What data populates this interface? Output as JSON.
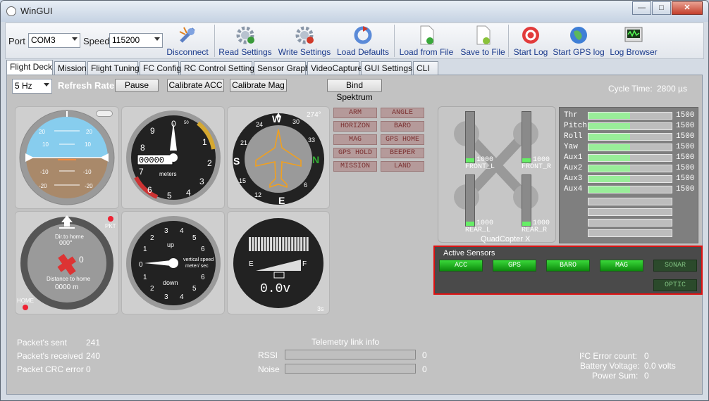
{
  "window": {
    "title": "WinGUI",
    "minimize": "—",
    "maximize": "□",
    "close": "✕"
  },
  "toolbar": {
    "port_label": "Port",
    "port_value": "COM3",
    "speed_label": "Speed",
    "speed_value": "115200",
    "buttons": [
      {
        "label": "Disconnect",
        "icon": "plug-disconnect-icon"
      },
      {
        "label": "Read Settings",
        "icon": "gear-read-icon"
      },
      {
        "label": "Write Settings",
        "icon": "gear-write-icon"
      },
      {
        "label": "Load Defaults",
        "icon": "reload-icon"
      },
      {
        "label": "Load from File",
        "icon": "file-load-icon"
      },
      {
        "label": "Save to File",
        "icon": "file-save-icon"
      },
      {
        "label": "Start Log",
        "icon": "record-icon"
      },
      {
        "label": "Start GPS log",
        "icon": "globe-icon"
      },
      {
        "label": "Log Browser",
        "icon": "log-browser-icon"
      }
    ]
  },
  "tabs": [
    "Flight Deck",
    "Mission",
    "Flight Tuning",
    "FC Config",
    "RC Control Settings",
    "Sensor Graph",
    "VideoCapture",
    "GUI Settings",
    "CLI"
  ],
  "controls": {
    "refresh_value": "5 Hz",
    "refresh_label": "Refresh Rate",
    "pause": "Pause",
    "calibrate_acc": "Calibrate ACC",
    "calibrate_mag": "Calibrate Mag",
    "bind": "Bind Spektrum",
    "cycle_label": "Cycle Time:",
    "cycle_value": "2800 µs"
  },
  "attitude": {
    "pitch_labels": [
      "20",
      "10",
      "-10",
      "-20"
    ]
  },
  "altimeter": {
    "numbers": [
      "0",
      "1",
      "2",
      "3",
      "4",
      "5",
      "6",
      "7",
      "8",
      "9"
    ],
    "counter": "00000",
    "unit": "meters",
    "top_small": "50"
  },
  "heading": {
    "value": "274°",
    "letters": [
      "W",
      "N",
      "S",
      "E"
    ],
    "numbers": [
      "30",
      "33",
      "24",
      "21",
      "12",
      "15",
      "6"
    ]
  },
  "home": {
    "dir_label": "Dir.to home",
    "dir_value": "000°",
    "dist_label": "Distance to home",
    "dist_value": "0000 m",
    "pkt": "PKT",
    "home": "HOME",
    "count": "0"
  },
  "vario": {
    "up": "up",
    "down": "down",
    "label1": "vertical speed",
    "label2": "meter/ sec",
    "nums_top": [
      "1",
      "2",
      "3",
      "4",
      "5",
      "6"
    ],
    "nums_bottom": [
      "1",
      "2",
      "3",
      "4",
      "5",
      "6"
    ],
    "zero": "0"
  },
  "battery": {
    "empty": "E",
    "full": "F",
    "voltage": "0.0v",
    "time": "3s"
  },
  "modes": [
    "ARM",
    "ANGLE",
    "HORIZON",
    "BARO",
    "MAG",
    "GPS HOME",
    "GPS HOLD",
    "BEEPER",
    "MISSION",
    "LAND"
  ],
  "motors": {
    "front_l": {
      "label": "FRONT_L",
      "value": "1000"
    },
    "front_r": {
      "label": "FRONT_R",
      "value": "1000"
    },
    "rear_l": {
      "label": "REAR_L",
      "value": "1000"
    },
    "rear_r": {
      "label": "REAR_R",
      "value": "1000"
    },
    "frame": "QuadCopter X"
  },
  "rc": [
    {
      "name": "Thr",
      "value": "1500",
      "level": 0.5
    },
    {
      "name": "Pitch",
      "value": "1500",
      "level": 0.5
    },
    {
      "name": "Roll",
      "value": "1500",
      "level": 0.5
    },
    {
      "name": "Yaw",
      "value": "1500",
      "level": 0.5
    },
    {
      "name": "Aux1",
      "value": "1500",
      "level": 0.5
    },
    {
      "name": "Aux2",
      "value": "1500",
      "level": 0.5
    },
    {
      "name": "Aux3",
      "value": "1500",
      "level": 0.5
    },
    {
      "name": "Aux4",
      "value": "1500",
      "level": 0.5
    }
  ],
  "sensors": {
    "title": "Active Sensors",
    "items": [
      "ACC",
      "GPS",
      "BARO",
      "MAG",
      "SONAR",
      "OPTIC"
    ]
  },
  "stats": {
    "sent_label": "Packet's sent",
    "sent": "241",
    "recv_label": "Packet's received",
    "recv": "240",
    "crc_label": "Packet CRC error",
    "crc": "0"
  },
  "telemetry": {
    "title": "Telemetry link info",
    "rssi_label": "RSSI",
    "rssi": "0",
    "noise_label": "Noise",
    "noise": "0"
  },
  "status": {
    "i2c_label": "I²C Error count:",
    "i2c": "0",
    "batt_label": "Battery Voltage:",
    "batt": "0.0 volts",
    "power_label": "Power Sum:",
    "power": "0"
  }
}
